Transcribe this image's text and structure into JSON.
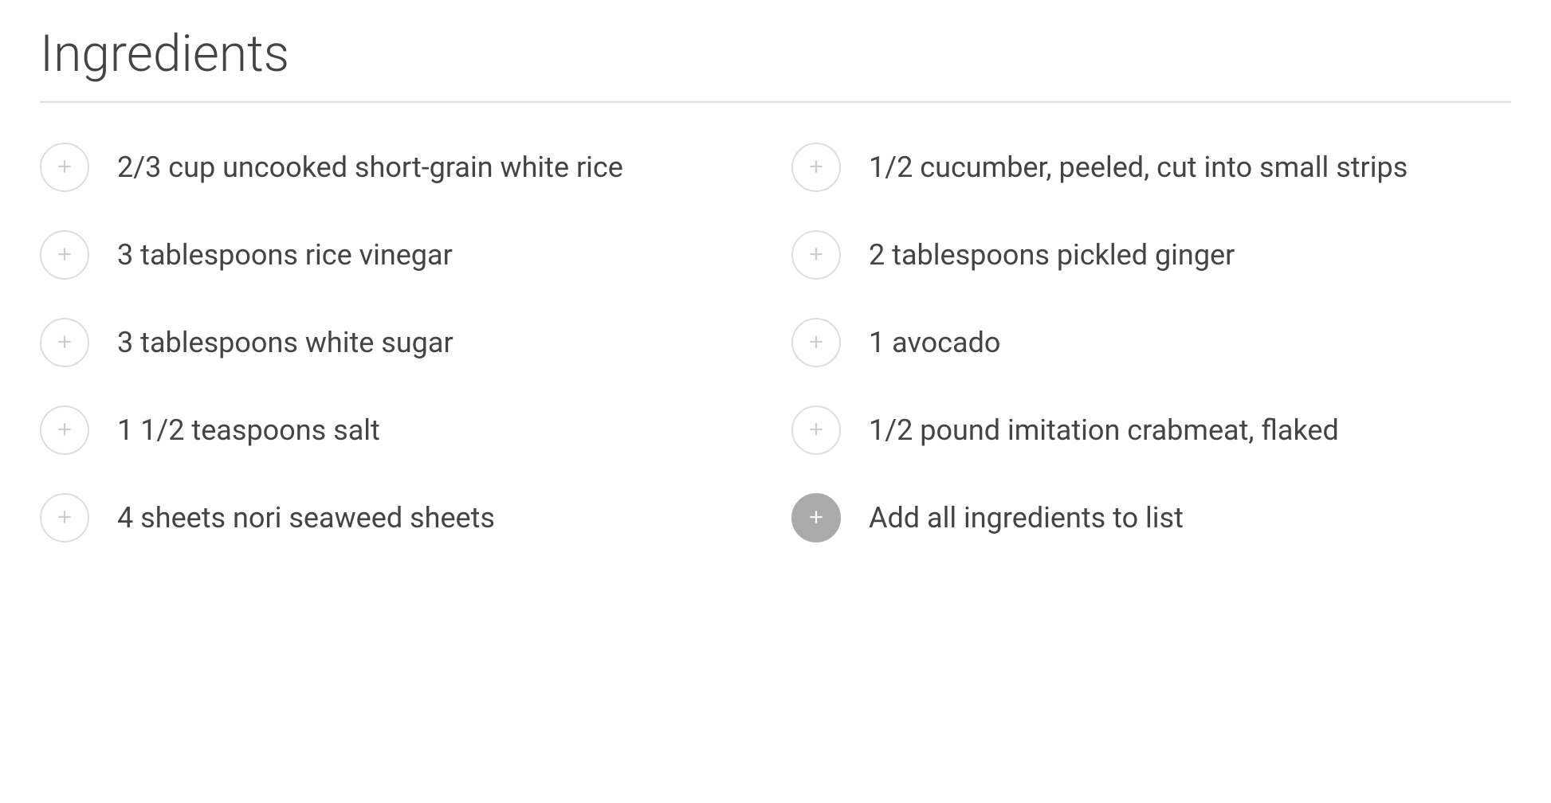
{
  "section_title": "Ingredients",
  "left_column": [
    "2/3 cup uncooked short-grain white rice",
    "3 tablespoons rice vinegar",
    "3 tablespoons white sugar",
    "1 1/2 teaspoons salt",
    "4 sheets nori seaweed sheets"
  ],
  "right_column": [
    "1/2 cucumber, peeled, cut into small strips",
    "2 tablespoons pickled ginger",
    "1 avocado",
    "1/2 pound imitation crabmeat, flaked"
  ],
  "add_all_label": "Add all ingredients to list"
}
